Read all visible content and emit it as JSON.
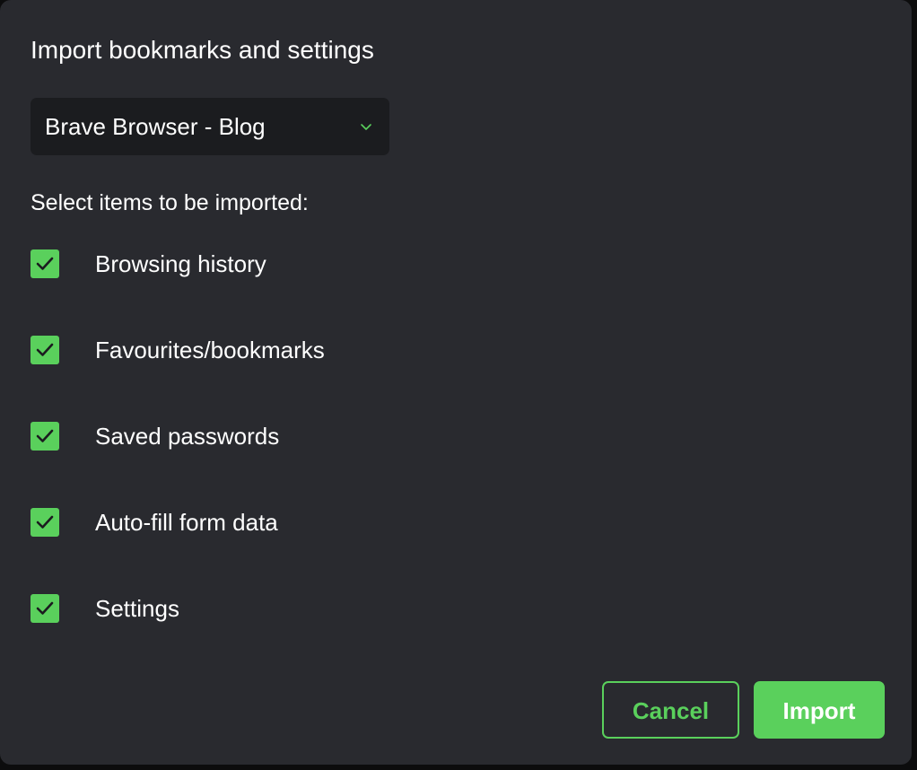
{
  "dialog": {
    "title": "Import bookmarks and settings",
    "profile_select": {
      "selected": "Brave Browser - Blog",
      "icon": "chevron-down-icon"
    },
    "prompt": "Select items to be imported:",
    "options": [
      {
        "label": "Browsing history",
        "checked": true
      },
      {
        "label": "Favourites/bookmarks",
        "checked": true
      },
      {
        "label": "Saved passwords",
        "checked": true
      },
      {
        "label": "Auto-fill form data",
        "checked": true
      },
      {
        "label": "Settings",
        "checked": true
      }
    ],
    "buttons": {
      "cancel": "Cancel",
      "import": "Import"
    }
  },
  "colors": {
    "background": "#292a2f",
    "select_background": "#1b1c1f",
    "accent": "#5ad05c",
    "text": "#ffffff"
  }
}
